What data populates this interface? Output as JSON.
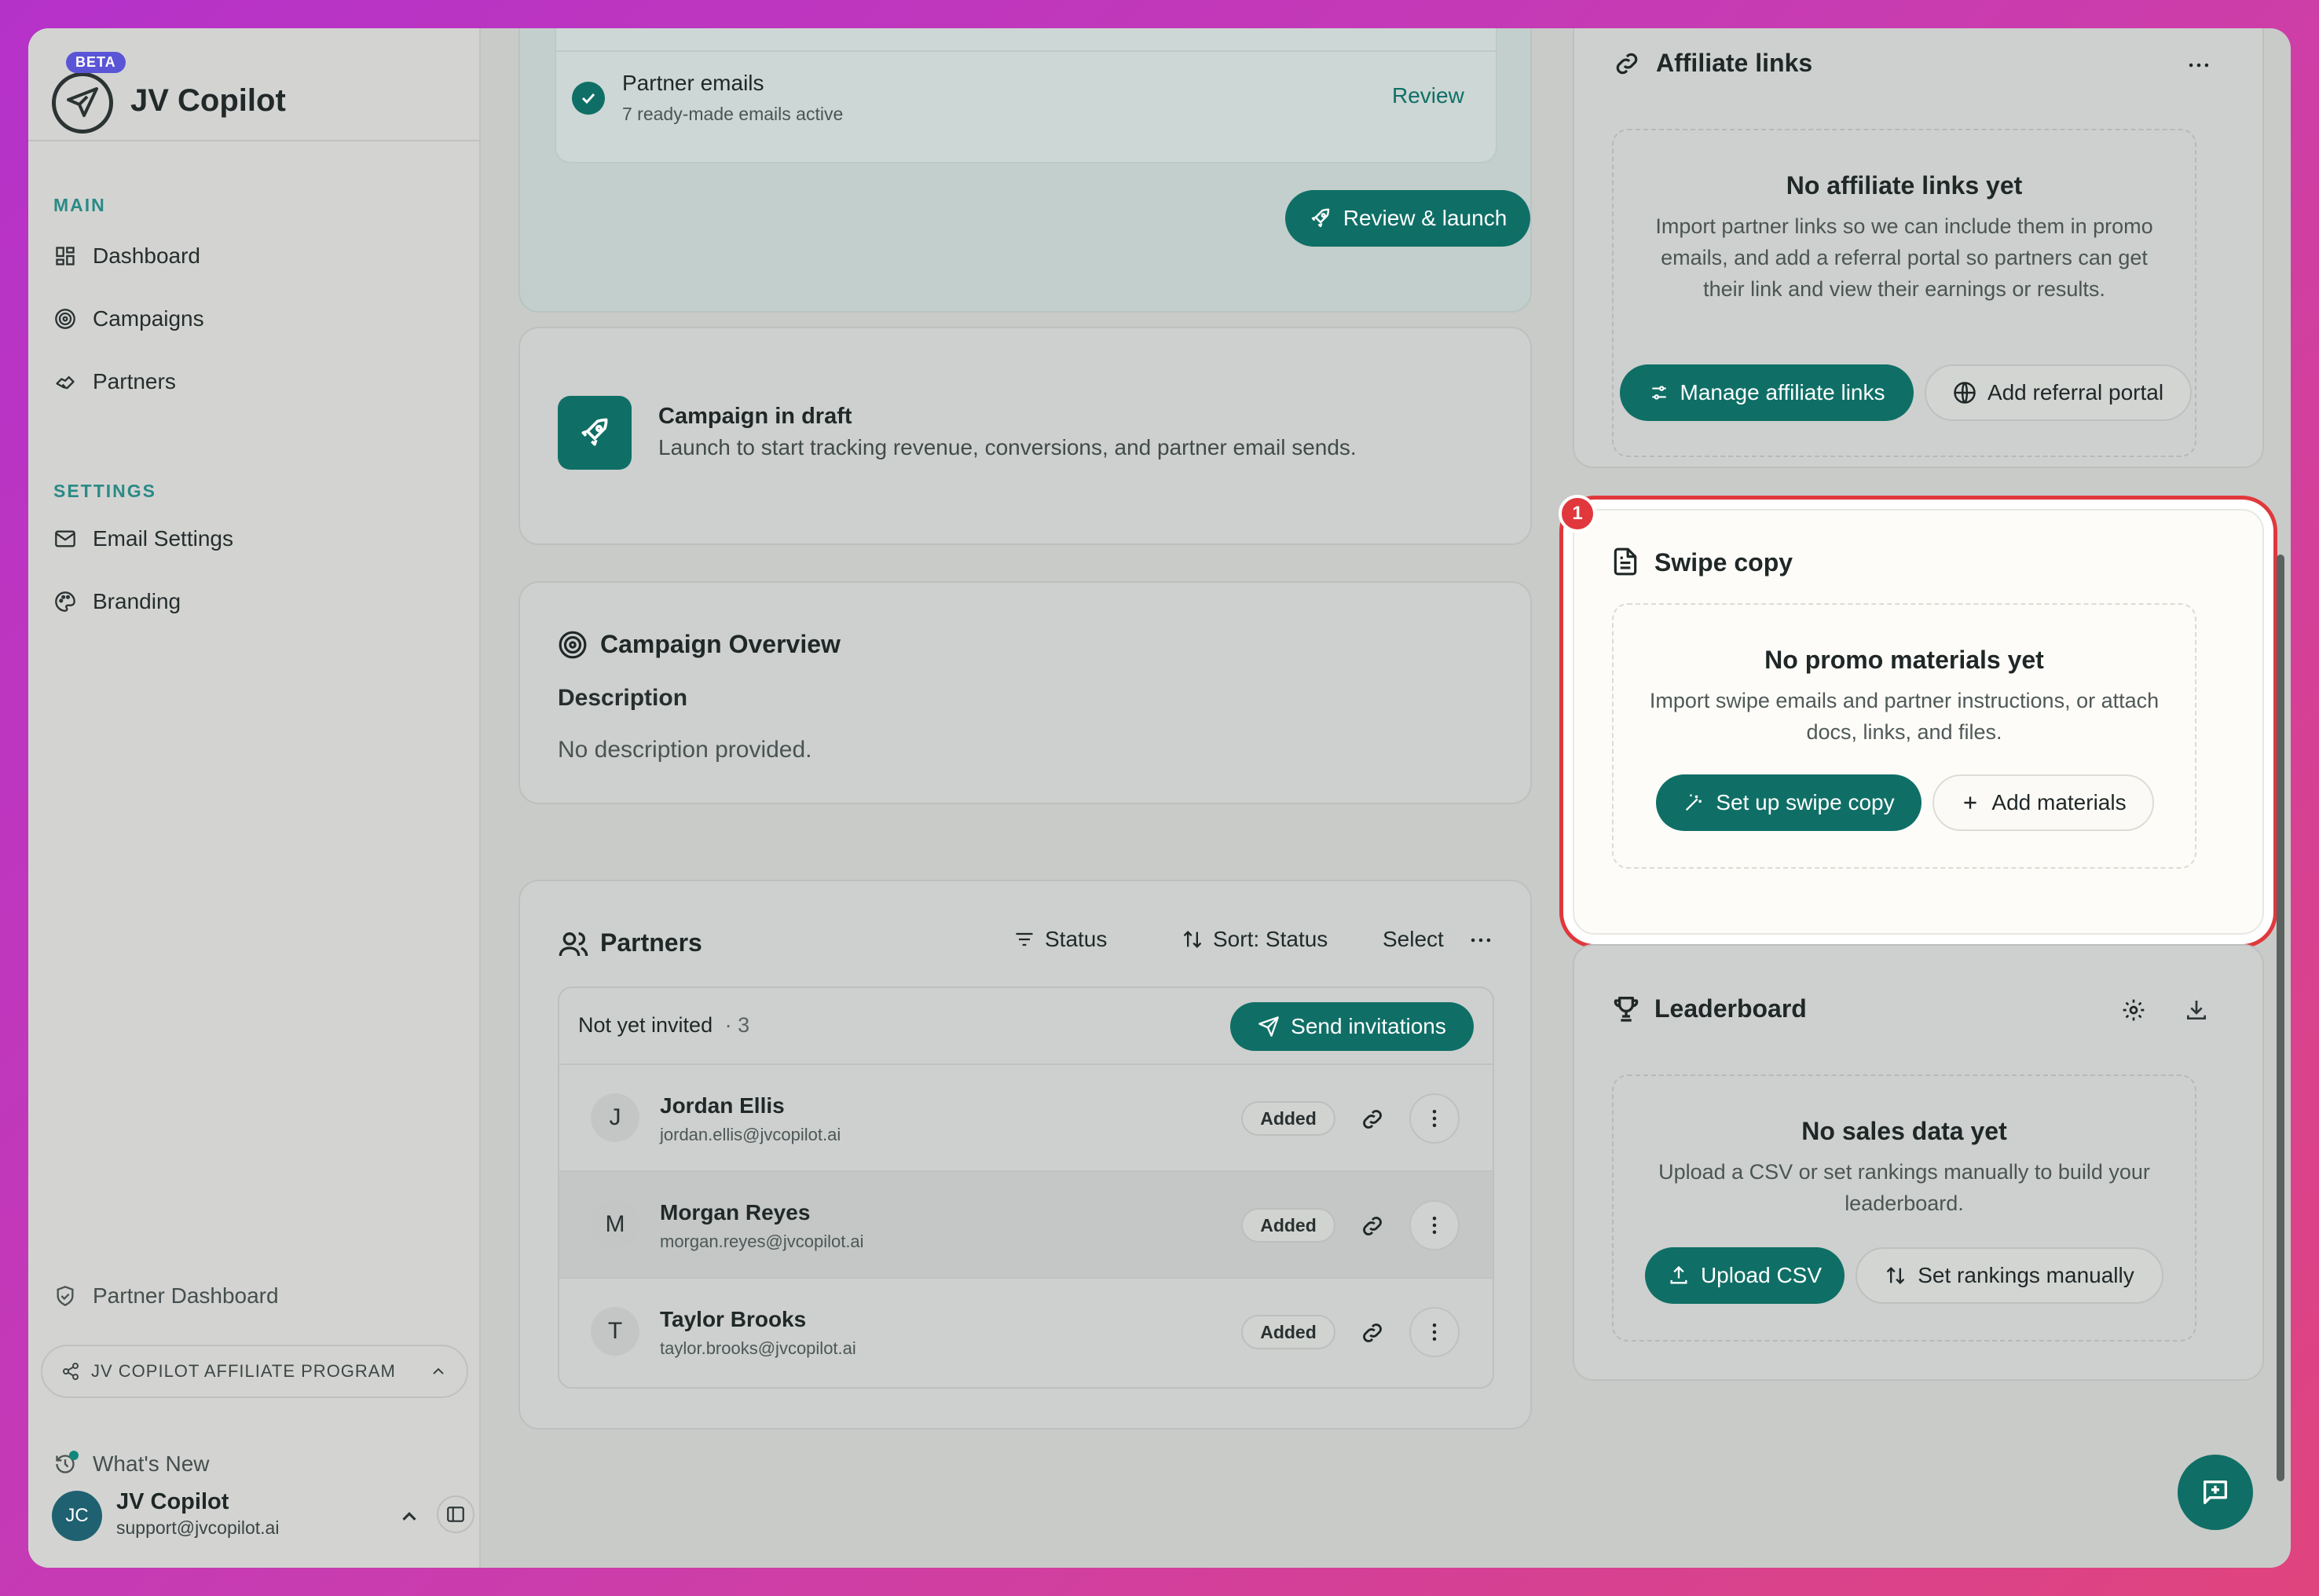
{
  "brand": {
    "name": "JV Copilot",
    "beta": "BETA"
  },
  "sidebar": {
    "main_label": "MAIN",
    "main_items": [
      {
        "label": "Dashboard",
        "icon": "dashboard-icon"
      },
      {
        "label": "Campaigns",
        "icon": "target-icon"
      },
      {
        "label": "Partners",
        "icon": "handshake-icon"
      }
    ],
    "settings_label": "SETTINGS",
    "settings_items": [
      {
        "label": "Email Settings",
        "icon": "mail-icon"
      },
      {
        "label": "Branding",
        "icon": "palette-icon"
      }
    ],
    "partner_dashboard": "Partner Dashboard",
    "affiliate_program": "JV COPILOT AFFILIATE PROGRAM",
    "whats_new": "What's New",
    "user": {
      "initials": "JC",
      "name": "JV Copilot",
      "email": "support@jvcopilot.ai"
    }
  },
  "launch_card": {
    "partner_emails_title": "Partner emails",
    "partner_emails_sub": "7 ready-made emails active",
    "review_link": "Review",
    "review_launch_button": "Review & launch"
  },
  "draft_card": {
    "title": "Campaign in draft",
    "subtitle": "Launch to start tracking revenue, conversions, and partner email sends."
  },
  "overview_card": {
    "title": "Campaign Overview",
    "desc_label": "Description",
    "desc_value": "No description provided."
  },
  "partners_card": {
    "title": "Partners",
    "filter_status": "Status",
    "sort_status": "Sort: Status",
    "select": "Select",
    "group_label": "Not yet invited",
    "group_count": "· 3",
    "send_invitations": "Send invitations",
    "rows": [
      {
        "initial": "J",
        "name": "Jordan Ellis",
        "email": "jordan.ellis@jvcopilot.ai",
        "badge": "Added"
      },
      {
        "initial": "M",
        "name": "Morgan Reyes",
        "email": "morgan.reyes@jvcopilot.ai",
        "badge": "Added"
      },
      {
        "initial": "T",
        "name": "Taylor Brooks",
        "email": "taylor.brooks@jvcopilot.ai",
        "badge": "Added"
      }
    ]
  },
  "affiliate_card": {
    "title": "Affiliate links",
    "empty_title": "No affiliate links yet",
    "empty_desc": "Import partner links so we can include them in promo emails, and add a referral portal so partners can get their link and view their earnings or results.",
    "manage_button": "Manage affiliate links",
    "referral_button": "Add referral portal"
  },
  "swipe_card": {
    "marker": "1",
    "title": "Swipe copy",
    "empty_title": "No promo materials yet",
    "empty_desc": "Import swipe emails and partner instructions, or attach docs, links, and files.",
    "setup_button": "Set up swipe copy",
    "add_button": "Add materials"
  },
  "leaderboard_card": {
    "title": "Leaderboard",
    "empty_title": "No sales data yet",
    "empty_desc": "Upload a CSV or set rankings manually to build your leaderboard.",
    "upload_button": "Upload CSV",
    "manual_button": "Set rankings manually"
  },
  "colors": {
    "accent": "#0f6f66",
    "highlight": "#e0383c",
    "beta": "#5a55d6"
  }
}
